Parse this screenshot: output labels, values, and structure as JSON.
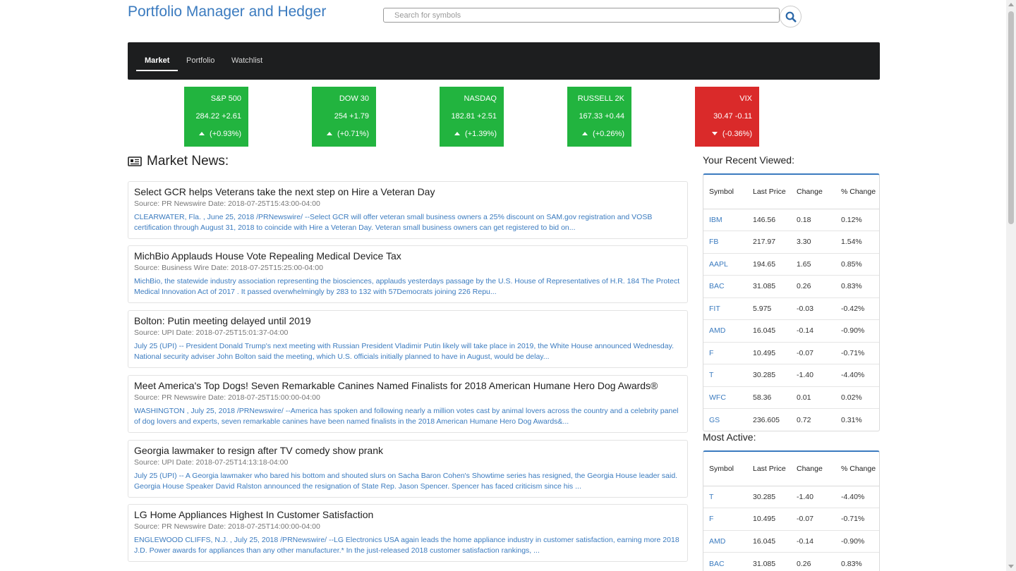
{
  "app": {
    "title": "Portfolio Manager and Hedger"
  },
  "search": {
    "placeholder": "Search for symbols"
  },
  "nav": {
    "tabs": [
      "Market",
      "Portfolio",
      "Watchlist"
    ],
    "active": "Market"
  },
  "indices": [
    {
      "name": "S&P 500",
      "price": "284.22",
      "change": "+2.61",
      "pct": "(+0.93%)",
      "direction": "up"
    },
    {
      "name": "DOW 30",
      "price": "254",
      "change": "+1.79",
      "pct": "(+0.71%)",
      "direction": "up"
    },
    {
      "name": "NASDAQ",
      "price": "182.81",
      "change": "+2.51",
      "pct": "(+1.39%)",
      "direction": "up"
    },
    {
      "name": "RUSSELL 2K",
      "price": "167.33",
      "change": "+0.44",
      "pct": "(+0.26%)",
      "direction": "up"
    },
    {
      "name": "VIX",
      "price": "30.47",
      "change": "-0.11",
      "pct": "(-0.36%)",
      "direction": "down"
    }
  ],
  "colors": {
    "up": "#22b43f",
    "down": "#da2a2a",
    "accent": "#3b7bbf",
    "navbar": "#1d1e1f"
  },
  "news": {
    "heading": "Market News:",
    "icon": "newspaper-icon",
    "items": [
      {
        "title": "Select GCR helps Veterans take the next step on Hire a Veteran Day",
        "source": "Source: PR Newswire Date: 2018-07-25T15:43:00-04:00",
        "summary": "CLEARWATER, Fla. , June 25, 2018 /PRNewswire/ --Select GCR will offer veteran small business owners a 25% discount on SAM.gov registration and VOSB certification through August 31, 2018 to coincide with Hire a Veteran Day. Veteran small business owners can get registered to bid on..."
      },
      {
        "title": "MichBio Applauds House Vote Repealing Medical Device Tax",
        "source": "Source: Business Wire Date: 2018-07-25T15:25:00-04:00",
        "summary": "MichBio, the statewide industry association representing the biosciences, applauds yesterdays passage by the U.S. House of Representatives of H.R. 184 The Protect Medical Innovation Act of 2017 . It passed overwhelmingly by 283 to 132 with 57Democrats joining 226 Repu..."
      },
      {
        "title": "Bolton: Putin meeting delayed until 2019",
        "source": "Source: UPI Date: 2018-07-25T15:01:37-04:00",
        "summary": "July 25 (UPI) -- President Donald Trump's next meeting with Russian President Vladimir Putin likely will take place in 2019, the White House announced Wednesday. National security adviser John Bolton said the meeting, which U.S. officials initially planned to have in August, would be delay..."
      },
      {
        "title": "Meet America's Top Dogs! Seven Remarkable Canines Named Finalists for 2018 American Humane Hero Dog Awards®",
        "source": "Source: PR Newswire Date: 2018-07-25T15:00:00-04:00",
        "summary": "WASHINGTON , July 25, 2018 /PRNewswire/ --America has spoken and following nearly a million votes cast by animal lovers across the country and a celebrity panel of dog lovers and experts, seven remarkable canines have been named finalists in the 2018 American Humane Hero Dog Awards&..."
      },
      {
        "title": "Georgia lawmaker to resign after TV comedy show prank",
        "source": "Source: UPI Date: 2018-07-25T14:13:18-04:00",
        "summary": "July 25 (UPI) -- A Georgia lawmaker who bared his bottom and shouted slurs on Sacha Baron Cohen's Showtime series has resigned, the Georgia House leader said. Georgia House Speaker David Ralston announced the resignation of State Rep. Jason Spencer. Spencer has faced criticism since his ..."
      },
      {
        "title": "LG Home Appliances Highest In Customer Satisfaction",
        "source": "Source: PR Newswire Date: 2018-07-25T14:00:00-04:00",
        "summary": "ENGLEWOOD CLIFFS, N.J. , July 25, 2018 /PRNewswire/ --LG Electronics USA again leads the home appliance industry in customer satisfaction, earning more 2018 J.D. Power awards for appliances than any other manufacturer.* In the just-released 2018 customer satisfaction rankings, ..."
      }
    ]
  },
  "recent": {
    "heading": "Your Recent Viewed:",
    "columns": [
      "Symbol",
      "Last Price",
      "Change",
      "% Change"
    ],
    "rows": [
      [
        "IBM",
        "146.56",
        "0.18",
        "0.12%"
      ],
      [
        "FB",
        "217.97",
        "3.30",
        "1.54%"
      ],
      [
        "AAPL",
        "194.65",
        "1.65",
        "0.85%"
      ],
      [
        "BAC",
        "31.085",
        "0.26",
        "0.83%"
      ],
      [
        "FIT",
        "5.975",
        "-0.03",
        "-0.42%"
      ],
      [
        "AMD",
        "16.045",
        "-0.14",
        "-0.90%"
      ],
      [
        "F",
        "10.495",
        "-0.07",
        "-0.71%"
      ],
      [
        "T",
        "30.285",
        "-1.40",
        "-4.40%"
      ],
      [
        "WFC",
        "58.36",
        "0.01",
        "0.02%"
      ],
      [
        "GS",
        "236.605",
        "0.72",
        "0.31%"
      ]
    ]
  },
  "active": {
    "heading": "Most Active:",
    "columns": [
      "Symbol",
      "Last Price",
      "Change",
      "% Change"
    ],
    "rows": [
      [
        "T",
        "30.285",
        "-1.40",
        "-4.40%"
      ],
      [
        "F",
        "10.495",
        "-0.07",
        "-0.71%"
      ],
      [
        "AMD",
        "16.045",
        "-0.14",
        "-0.90%"
      ],
      [
        "BAC",
        "31.085",
        "0.26",
        "0.83%"
      ]
    ]
  }
}
